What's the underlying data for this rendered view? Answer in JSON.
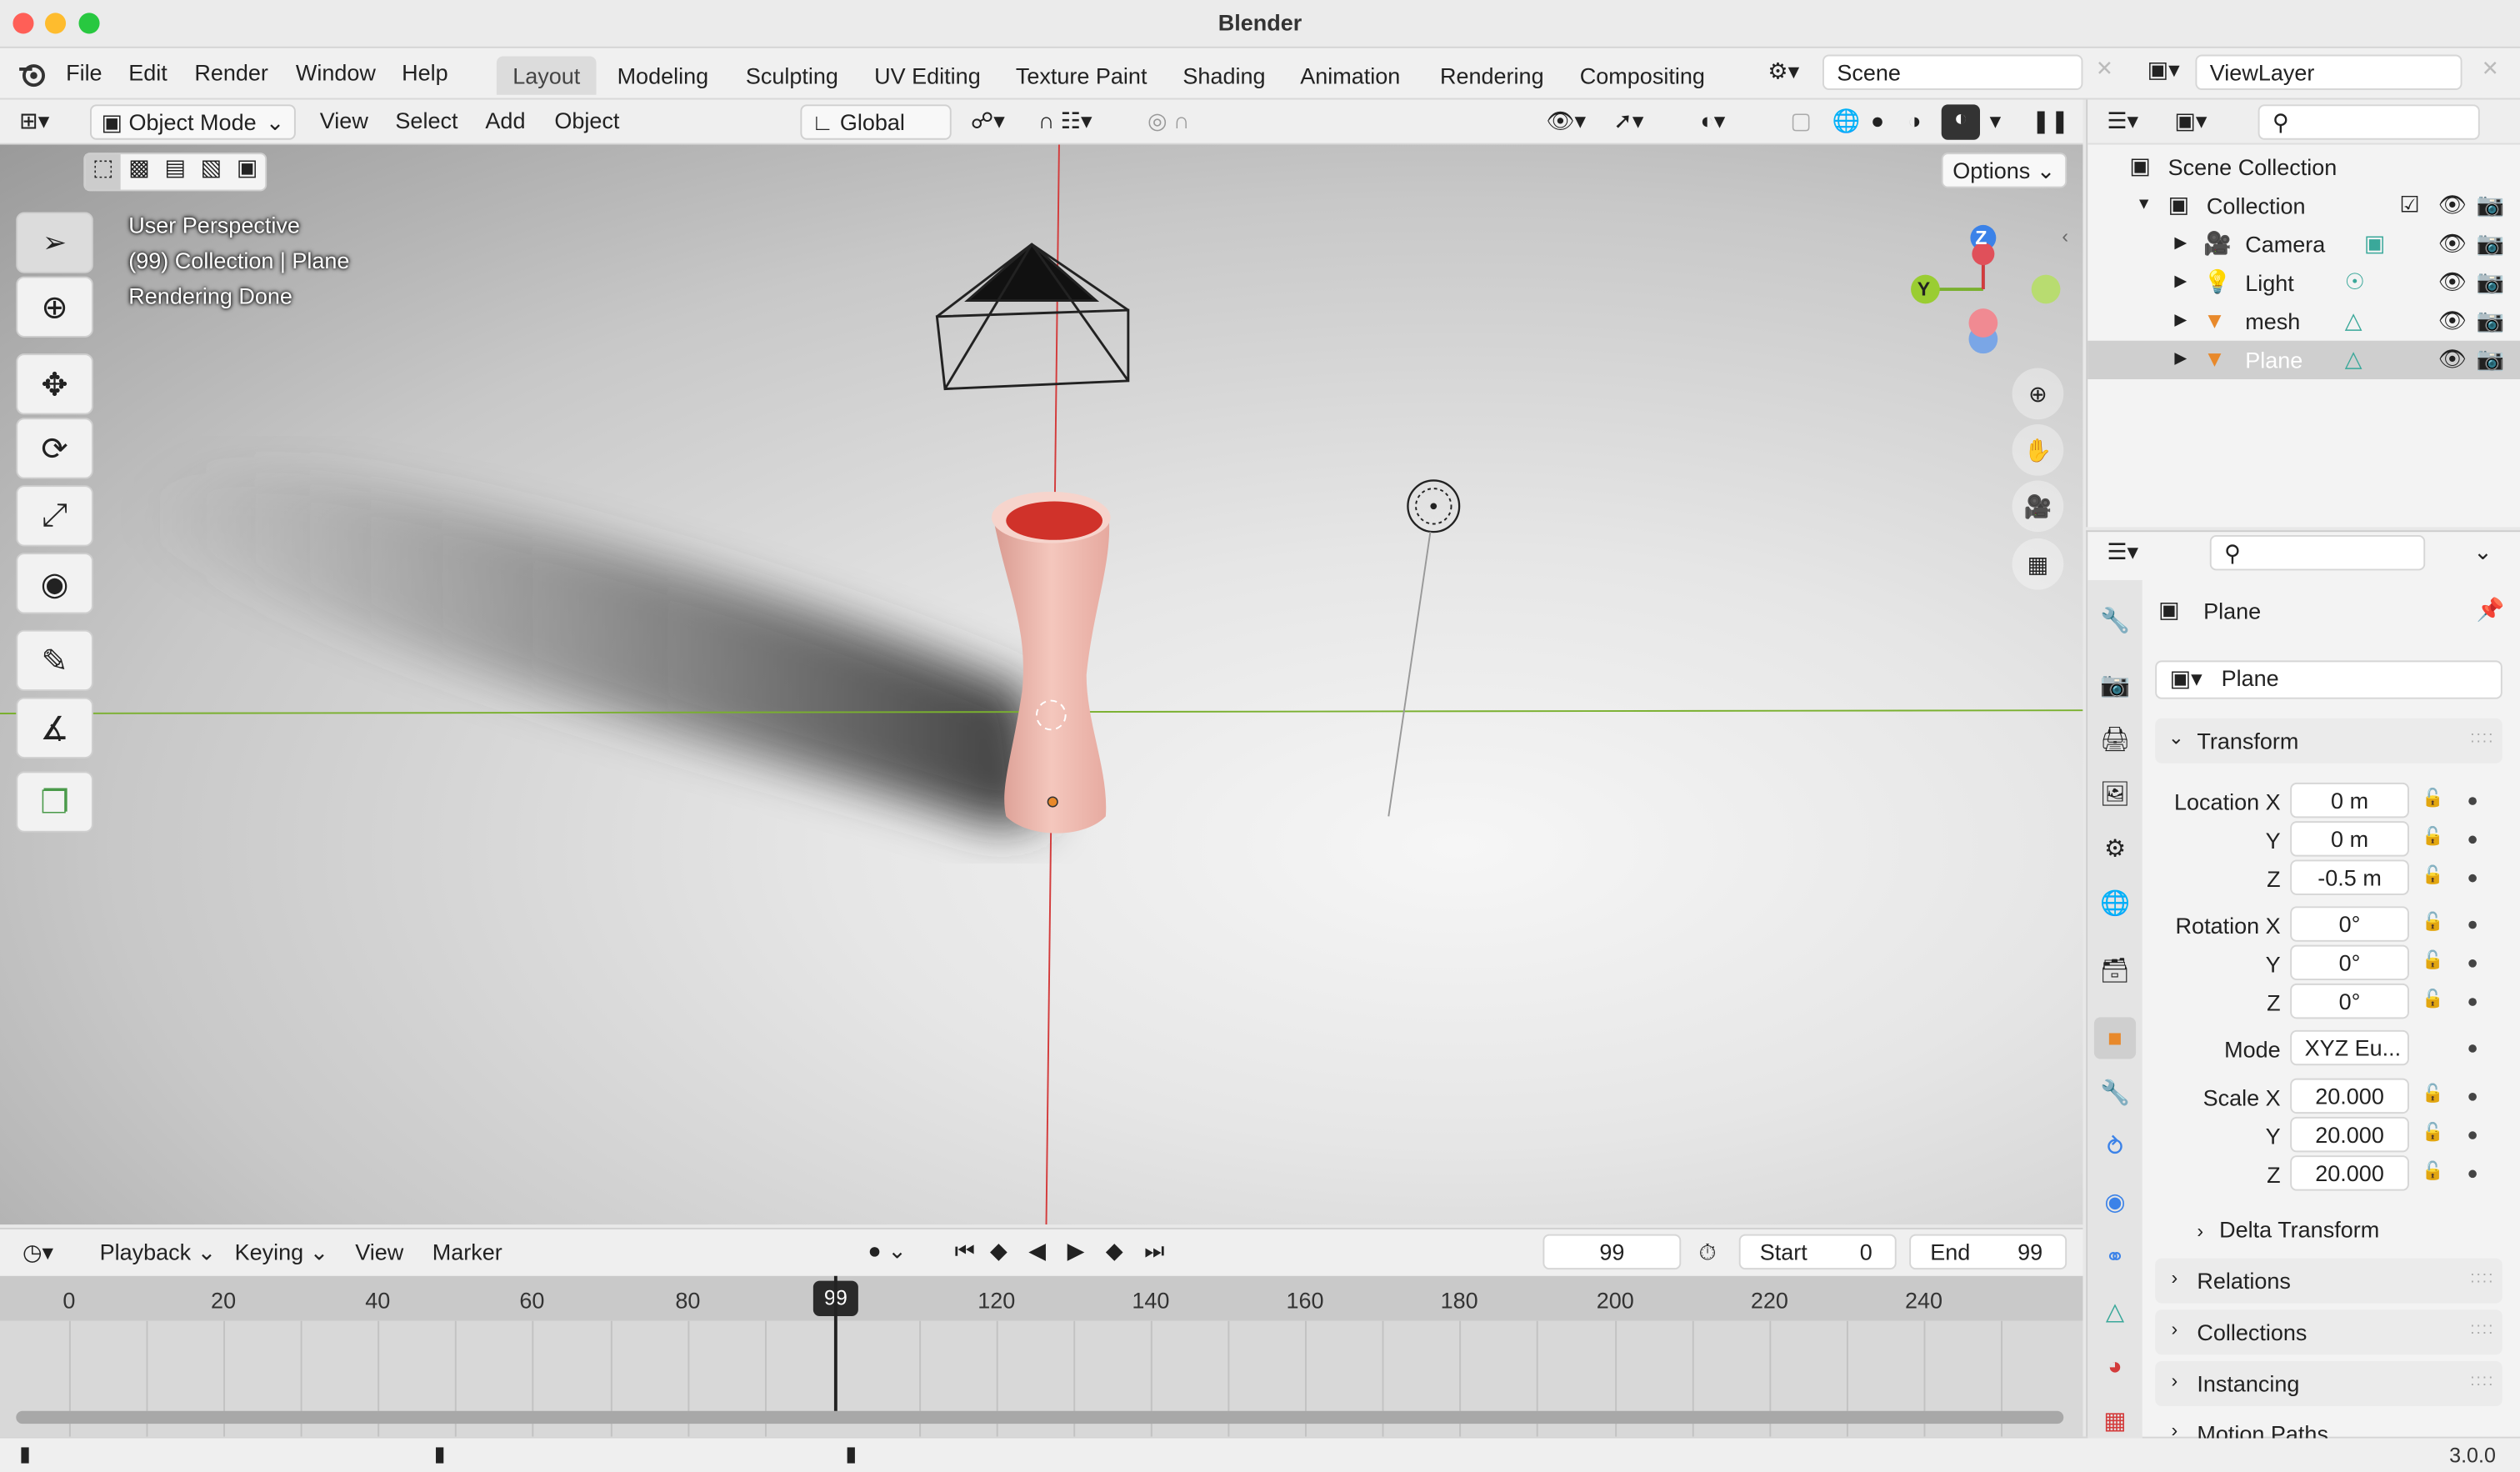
{
  "app": {
    "title": "Blender",
    "version": "3.0.0"
  },
  "menu": [
    "File",
    "Edit",
    "Render",
    "Window",
    "Help"
  ],
  "workspaces": [
    "Layout",
    "Modeling",
    "Sculpting",
    "UV Editing",
    "Texture Paint",
    "Shading",
    "Animation",
    "Rendering",
    "Compositing"
  ],
  "scene": {
    "name": "Scene",
    "view_layer": "ViewLayer"
  },
  "viewport_header": {
    "mode": "Object Mode",
    "view": "View",
    "select": "Select",
    "add": "Add",
    "object": "Object",
    "transform_orientation": "Global"
  },
  "viewport": {
    "options_label": "Options",
    "info_line1": "User Perspective",
    "info_line2": "(99) Collection | Plane",
    "info_line3": "Rendering Done",
    "gizmo": {
      "z": "Z",
      "y": "Y"
    }
  },
  "timeline": {
    "playback": "Playback",
    "keying": "Keying",
    "view": "View",
    "marker": "Marker",
    "current_frame": "99",
    "start_label": "Start",
    "start": "0",
    "end_label": "End",
    "end": "99",
    "ticks": [
      "0",
      "20",
      "40",
      "60",
      "80",
      "99",
      "120",
      "140",
      "160",
      "180",
      "200",
      "220",
      "240"
    ]
  },
  "outliner": {
    "root": "Scene Collection",
    "collection": "Collection",
    "items": [
      {
        "name": "Camera",
        "icon": "camera-icon"
      },
      {
        "name": "Light",
        "icon": "light-icon"
      },
      {
        "name": "mesh",
        "icon": "mesh-icon"
      },
      {
        "name": "Plane",
        "icon": "mesh-icon",
        "selected": true
      }
    ]
  },
  "properties": {
    "object_name": "Plane",
    "data_name": "Plane",
    "transform_label": "Transform",
    "location_label": "Location X",
    "y_label": "Y",
    "z_label": "Z",
    "location": {
      "x": "0 m",
      "y": "0 m",
      "z": "-0.5 m"
    },
    "rotation_label": "Rotation X",
    "rotation": {
      "x": "0°",
      "y": "0°",
      "z": "0°"
    },
    "mode_label": "Mode",
    "mode": "XYZ Eu...",
    "scale_label": "Scale X",
    "scale": {
      "x": "20.000",
      "y": "20.000",
      "z": "20.000"
    },
    "panels": [
      "Delta Transform",
      "Relations",
      "Collections",
      "Instancing",
      "Motion Paths"
    ]
  },
  "colors": {
    "accent_orange": "#e8892b",
    "x_axis": "#d33b3b",
    "y_axis": "#7ab02f",
    "z_axis": "#3b82e8"
  }
}
